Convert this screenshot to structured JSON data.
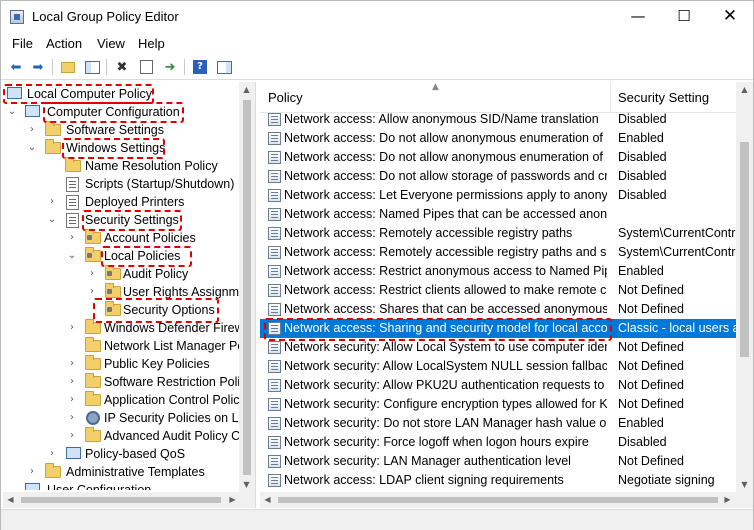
{
  "window": {
    "title": "Local Group Policy Editor"
  },
  "menubar": {
    "items": [
      "File",
      "Action",
      "View",
      "Help"
    ]
  },
  "toolbar": {
    "buttons": [
      "back-arrow-icon",
      "forward-arrow-icon",
      "up-folder-icon",
      "show-hide-tree-icon",
      "delete-icon",
      "properties-icon",
      "export-list-icon",
      "help-icon",
      "show-pane-icon"
    ]
  },
  "tree": {
    "items": [
      {
        "label": "Local Computer Policy"
      },
      {
        "label": "Computer Configuration"
      },
      {
        "label": "Software Settings"
      },
      {
        "label": "Windows Settings"
      },
      {
        "label": "Name Resolution Policy"
      },
      {
        "label": "Scripts (Startup/Shutdown)"
      },
      {
        "label": "Deployed Printers"
      },
      {
        "label": "Security Settings"
      },
      {
        "label": "Account Policies"
      },
      {
        "label": "Local Policies"
      },
      {
        "label": "Audit Policy"
      },
      {
        "label": "User Rights Assignme"
      },
      {
        "label": "Security Options"
      },
      {
        "label": "Windows Defender Firewa"
      },
      {
        "label": "Network List Manager Po"
      },
      {
        "label": "Public Key Policies"
      },
      {
        "label": "Software Restriction Polic"
      },
      {
        "label": "Application Control Polic"
      },
      {
        "label": "IP Security Policies on Loc"
      },
      {
        "label": "Advanced Audit Policy Co"
      },
      {
        "label": "Policy-based QoS"
      },
      {
        "label": "Administrative Templates"
      },
      {
        "label": "User Configuration"
      }
    ]
  },
  "list": {
    "columns": {
      "policy": "Policy",
      "setting": "Security Setting"
    },
    "rows": [
      {
        "policy": "Network access: Allow anonymous SID/Name translation",
        "setting": "Disabled"
      },
      {
        "policy": "Network access: Do not allow anonymous enumeration of S...",
        "setting": "Enabled"
      },
      {
        "policy": "Network access: Do not allow anonymous enumeration of S...",
        "setting": "Disabled"
      },
      {
        "policy": "Network access: Do not allow storage of passwords and cre...",
        "setting": "Disabled"
      },
      {
        "policy": "Network access: Let Everyone permissions apply to anonym...",
        "setting": "Disabled"
      },
      {
        "policy": "Network access: Named Pipes that can be accessed anonym...",
        "setting": ""
      },
      {
        "policy": "Network access: Remotely accessible registry paths",
        "setting": "System\\CurrentContro"
      },
      {
        "policy": "Network access: Remotely accessible registry paths and sub...",
        "setting": "System\\CurrentContro"
      },
      {
        "policy": "Network access: Restrict anonymous access to Named Pipes...",
        "setting": "Enabled"
      },
      {
        "policy": "Network access: Restrict clients allowed to make remote call...",
        "setting": "Not Defined"
      },
      {
        "policy": "Network access: Shares that can be accessed anonymously",
        "setting": "Not Defined"
      },
      {
        "policy": "Network access: Sharing and security model for local accou...",
        "setting": "Classic - local users au"
      },
      {
        "policy": "Network security: Allow Local System to use computer ident...",
        "setting": "Not Defined"
      },
      {
        "policy": "Network security: Allow LocalSystem NULL session fallback",
        "setting": "Not Defined"
      },
      {
        "policy": "Network security: Allow PKU2U authentication requests to t...",
        "setting": "Not Defined"
      },
      {
        "policy": "Network security: Configure encryption types allowed for Ke...",
        "setting": "Not Defined"
      },
      {
        "policy": "Network security: Do not store LAN Manager hash value on ...",
        "setting": "Enabled"
      },
      {
        "policy": "Network security: Force logoff when logon hours expire",
        "setting": "Disabled"
      },
      {
        "policy": "Network security: LAN Manager authentication level",
        "setting": "Not Defined"
      },
      {
        "policy": "Network access: LDAP client signing requirements",
        "setting": "Negotiate signing"
      }
    ]
  },
  "colors": {
    "selection": "#0078d7",
    "highlight_border": "#e00000"
  }
}
